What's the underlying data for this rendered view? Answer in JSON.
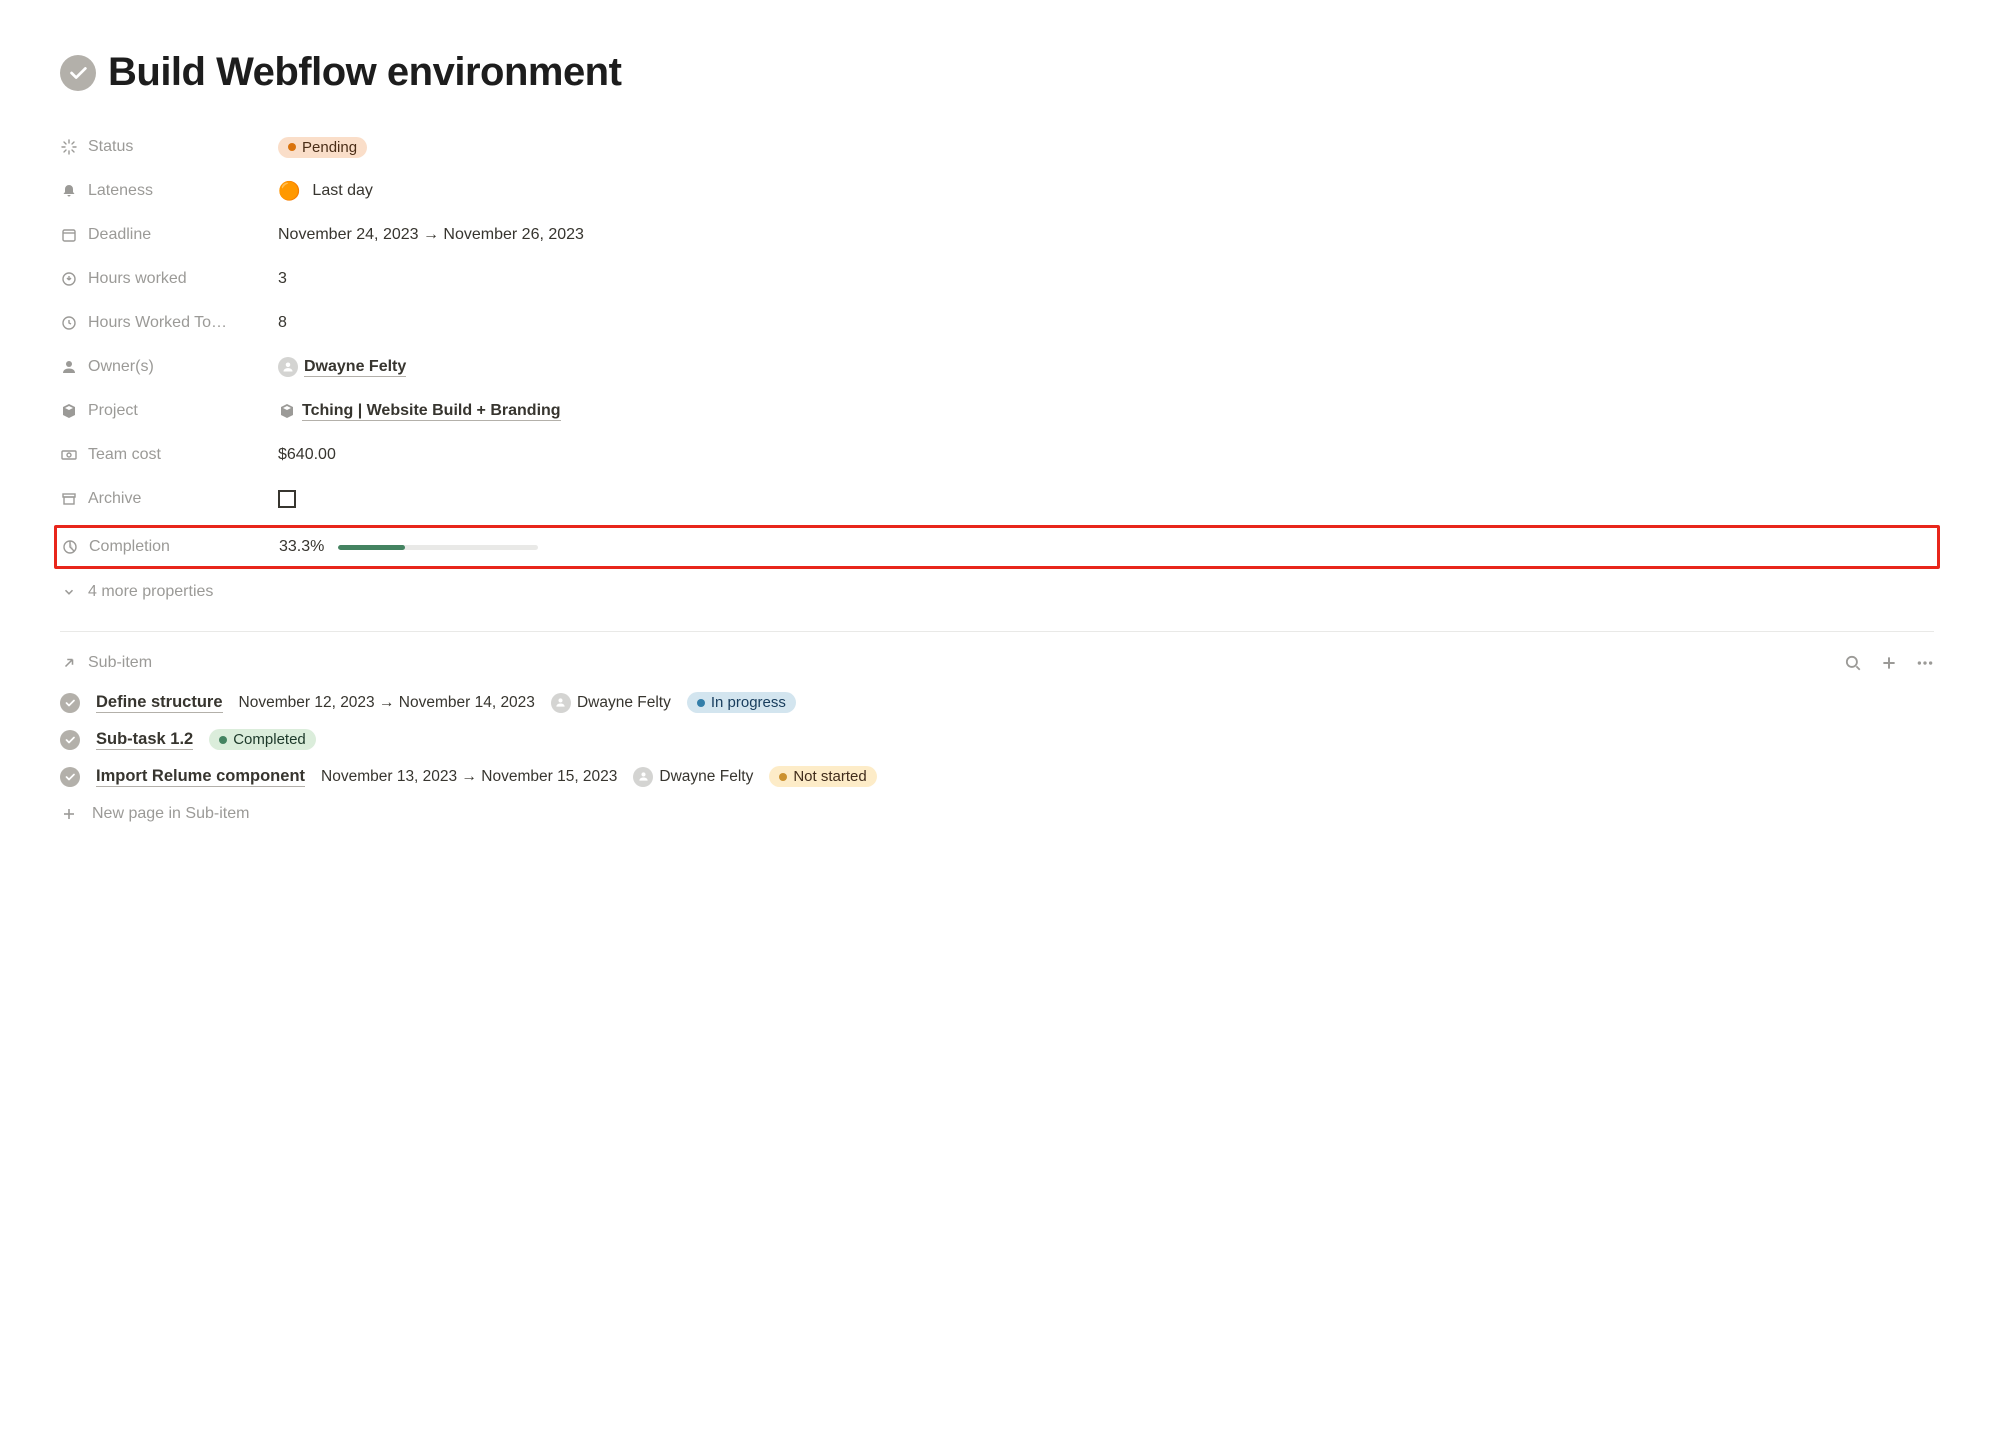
{
  "page": {
    "title": "Build Webflow environment"
  },
  "props": {
    "status": {
      "label": "Status",
      "value": "Pending"
    },
    "lateness": {
      "label": "Lateness",
      "emoji": "🟠",
      "value": "Last day"
    },
    "deadline": {
      "label": "Deadline",
      "value": "November 24, 2023 → November 26, 2023"
    },
    "hours_worked": {
      "label": "Hours worked",
      "value": "3"
    },
    "hours_today": {
      "label": "Hours Worked To…",
      "value": "8"
    },
    "owners": {
      "label": "Owner(s)",
      "value": "Dwayne Felty"
    },
    "project": {
      "label": "Project",
      "value": "Tching | Website Build + Branding"
    },
    "team_cost": {
      "label": "Team cost",
      "value": "$640.00"
    },
    "archive": {
      "label": "Archive"
    },
    "completion": {
      "label": "Completion",
      "value": "33.3%",
      "percent": 33.3
    },
    "more": {
      "label": "4 more properties"
    }
  },
  "subitems": {
    "header": "Sub-item",
    "new_page": "New page in Sub-item",
    "items": [
      {
        "title": "Define structure",
        "date": "November 12, 2023 → November 14, 2023",
        "owner": "Dwayne Felty",
        "status": "In progress",
        "status_class": "pill-inprogress"
      },
      {
        "title": "Sub-task 1.2",
        "date": "",
        "owner": "",
        "status": "Completed",
        "status_class": "pill-completed"
      },
      {
        "title": "Import Relume component",
        "date": "November 13, 2023 → November 15, 2023",
        "owner": "Dwayne Felty",
        "status": "Not started",
        "status_class": "pill-notstarted"
      }
    ]
  }
}
